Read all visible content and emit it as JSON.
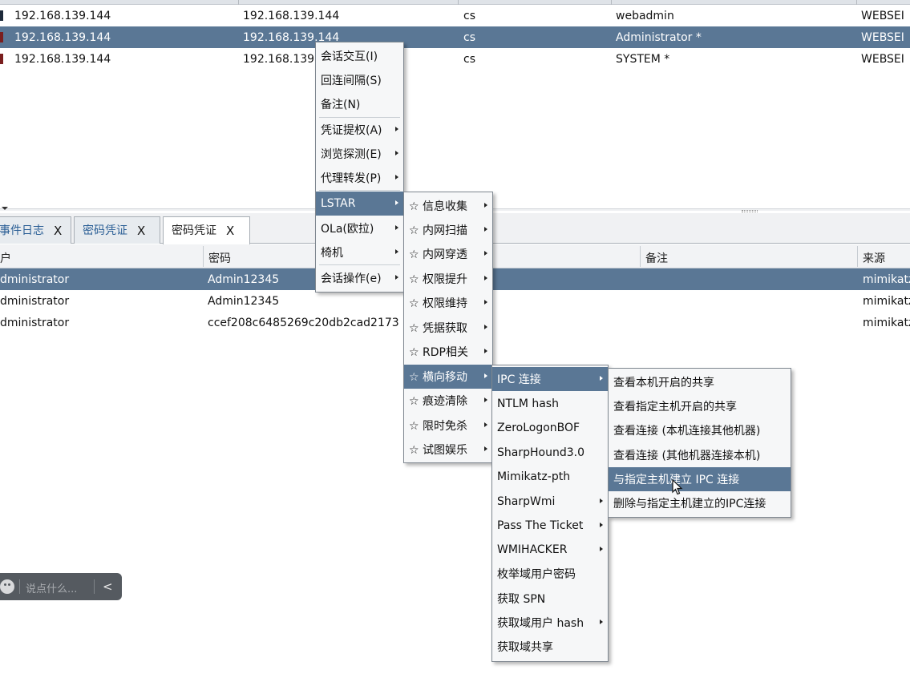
{
  "sessions": {
    "rows": [
      {
        "ext_ip": "192.168.139.144",
        "int_ip": "192.168.139.144",
        "listener": "cs",
        "user": "webadmin",
        "computer": "WEBSEI"
      },
      {
        "ext_ip": "192.168.139.144",
        "int_ip": "192.168.139.144",
        "listener": "cs",
        "user": "Administrator *",
        "computer": "WEBSEI"
      },
      {
        "ext_ip": "192.168.139.144",
        "int_ip": "192.168.139",
        "listener": "cs",
        "user": "SYSTEM *",
        "computer": "WEBSEI"
      }
    ]
  },
  "tabs": [
    {
      "label": "事件日志",
      "close": "X"
    },
    {
      "label": "密码凭证",
      "close": "X"
    },
    {
      "label": "密码凭证",
      "close": "X"
    }
  ],
  "credentials": {
    "columns": [
      "户",
      "密码",
      "备注",
      "来源"
    ],
    "rows": [
      {
        "user": "dministrator",
        "password": "Admin12345",
        "source": "mimikatz"
      },
      {
        "user": "dministrator",
        "password": "Admin12345",
        "source": "mimikatz"
      },
      {
        "user": "dministrator",
        "password": "ccef208c6485269c20db2cad2173",
        "source": "mimikatz"
      }
    ]
  },
  "chat": {
    "placeholder": "说点什么...",
    "back_glyph": "<"
  },
  "context_menu": {
    "items": [
      "会话交互(I)",
      "回连间隔(S)",
      "备注(N)",
      "凭证提权(A)",
      "浏览探测(E)",
      "代理转发(P)",
      "LSTAR",
      "OLa(欧拉)",
      "椅机",
      "会话操作(e)"
    ]
  },
  "lstar_menu": {
    "items": [
      "☆ 信息收集",
      "☆ 内网扫描",
      "☆ 内网穿透",
      "☆ 权限提升",
      "☆ 权限维持",
      "☆ 凭据获取",
      "☆ RDP相关",
      "☆ 横向移动",
      "☆ 痕迹清除",
      "☆ 限时免杀",
      "☆ 试图娱乐"
    ]
  },
  "lateral_menu": {
    "items": [
      "IPC 连接",
      "NTLM hash",
      "ZeroLogonBOF",
      "SharpHound3.0",
      "Mimikatz-pth",
      "SharpWmi",
      "Pass The Ticket",
      "WMIHACKER",
      "枚举域用户密码",
      "获取 SPN",
      "获取域用户 hash",
      "获取域共享"
    ]
  },
  "ipc_menu": {
    "items": [
      "查看本机开启的共享",
      "查看指定主机开启的共享",
      "查看连接 (本机连接其他机器)",
      "查看连接 (其他机器连接本机)",
      "与指定主机建立 IPC 连接",
      "删除与指定主机建立的IPC连接"
    ]
  },
  "colors": {
    "selection": "#5a7795",
    "tab_text": "#2a5e95",
    "menu_bg": "#f6f7f8"
  },
  "icons": [
    "session-icon",
    "smile-icon",
    "chevron-left-icon",
    "submenu-arrow-icon",
    "mouse-pointer-icon"
  ]
}
